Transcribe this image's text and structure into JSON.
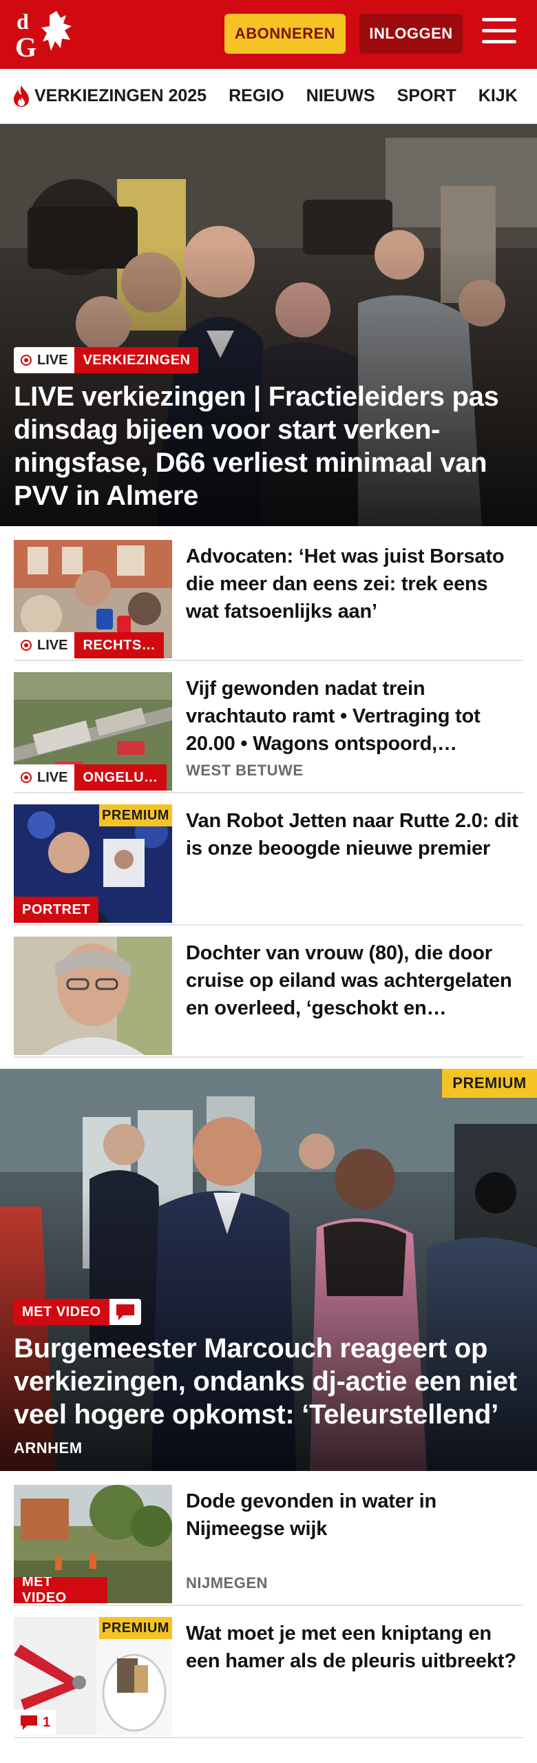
{
  "header": {
    "logo_letters": "dG",
    "subscribe_label": "ABONNEREN",
    "login_label": "INLOGGEN"
  },
  "nav": {
    "items": [
      {
        "label": "VERKIEZINGEN 2025",
        "icon": "flame-icon"
      },
      {
        "label": "REGIO"
      },
      {
        "label": "NIEUWS"
      },
      {
        "label": "SPORT"
      },
      {
        "label": "KIJK"
      }
    ]
  },
  "hero_1": {
    "live_label": "LIVE",
    "category": "VERKIEZINGEN",
    "title": "LIVE verkiezingen | Fractieleiders pas dinsdag bijeen voor start verken­ningsfase, D66 verliest minimaal van PVV in Almere"
  },
  "articles": [
    {
      "title": "Advocaten: ‘Het was juist Borsato die meer dan eens zei: trek eens wat fatsoenlijks aan’",
      "live_label": "LIVE",
      "category": "RECHTS…",
      "location": ""
    },
    {
      "title": "Vijf gewonden nadat trein vrachtauto ramt • Vertraging tot 20.00 • Wagons ontspoord,…",
      "live_label": "LIVE",
      "category": "ONGELU…",
      "location": "WEST BETUWE"
    },
    {
      "title": "Van Robot Jetten naar Rutte 2.0: dit is onze beoogde nieuwe premier",
      "category": "PORTRET",
      "premium_label": "PREMIUM",
      "location": ""
    },
    {
      "title": "Dochter van vrouw (80), die door cruise op eiland was achtergela­ten en overleed, ‘geschokt en…",
      "location": ""
    }
  ],
  "hero_2": {
    "premium_label": "PREMIUM",
    "category": "MET VIDEO",
    "title": "Burgemeester Marcouch reageert op verkiezingen, ondanks dj-actie een niet veel hogere opkomst: ‘Teleurstel­lend’",
    "location": "ARNHEM"
  },
  "articles_2": [
    {
      "title": "Dode gevonden in water in Nijmeegse wijk",
      "category": "MET VIDEO",
      "location": "NIJMEGEN"
    },
    {
      "title": "Wat moet je met een kniptang en een hamer als de pleuris uitbreekt?",
      "premium_label": "PREMIUM",
      "comment_count": "1"
    }
  ],
  "colors": {
    "brand_red": "#d10a11",
    "dark_red": "#9c0a0e",
    "premium_yellow": "#f6c324"
  }
}
